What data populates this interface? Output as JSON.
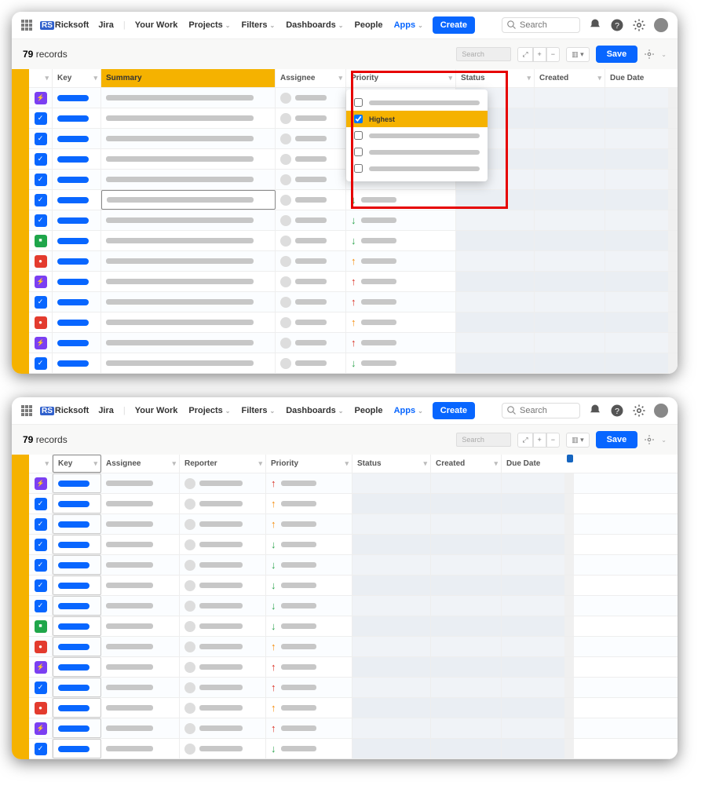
{
  "nav": {
    "brand": "Ricksoft",
    "jira": "Jira",
    "items": [
      "Your Work",
      "Projects",
      "Filters",
      "Dashboards",
      "People",
      "Apps"
    ],
    "active": "Apps",
    "create": "Create",
    "search_placeholder": "Search"
  },
  "toolbar": {
    "record_count": "79",
    "record_label": "records",
    "search_placeholder": "Search",
    "save": "Save"
  },
  "screen1": {
    "headers": {
      "key": "Key",
      "summary": "Summary",
      "assignee": "Assignee",
      "priority": "Priority",
      "status": "Status",
      "created": "Created",
      "due": "Due Date"
    },
    "dropdown": {
      "selected_label": "Highest",
      "options_count": 5,
      "selected_index": 1
    },
    "rows": [
      {
        "icon": "purple",
        "priority": null
      },
      {
        "icon": "blue",
        "priority": null
      },
      {
        "icon": "blue",
        "priority": null
      },
      {
        "icon": "blue",
        "priority": null
      },
      {
        "icon": "blue",
        "priority": null
      },
      {
        "icon": "blue",
        "priority": "down-green",
        "editing": true
      },
      {
        "icon": "blue",
        "priority": "down-green"
      },
      {
        "icon": "green",
        "priority": "down-green"
      },
      {
        "icon": "red",
        "priority": "up-orange"
      },
      {
        "icon": "purple",
        "priority": "up-red"
      },
      {
        "icon": "blue",
        "priority": "up-red"
      },
      {
        "icon": "red",
        "priority": "up-orange"
      },
      {
        "icon": "purple",
        "priority": "up-red"
      },
      {
        "icon": "blue",
        "priority": "down-green"
      }
    ]
  },
  "screen2": {
    "headers": {
      "key": "Key",
      "assignee": "Assignee",
      "reporter": "Reporter",
      "priority": "Priority",
      "status": "Status",
      "created": "Created",
      "due": "Due Date"
    },
    "rows": [
      {
        "icon": "purple",
        "priority": "up-red"
      },
      {
        "icon": "blue",
        "priority": "up-orange"
      },
      {
        "icon": "blue",
        "priority": "up-orange"
      },
      {
        "icon": "blue",
        "priority": "down-green"
      },
      {
        "icon": "blue",
        "priority": "down-green"
      },
      {
        "icon": "blue",
        "priority": "down-green"
      },
      {
        "icon": "blue",
        "priority": "down-green"
      },
      {
        "icon": "green",
        "priority": "down-green"
      },
      {
        "icon": "red",
        "priority": "up-orange"
      },
      {
        "icon": "purple",
        "priority": "up-red"
      },
      {
        "icon": "blue",
        "priority": "up-red"
      },
      {
        "icon": "red",
        "priority": "up-orange"
      },
      {
        "icon": "purple",
        "priority": "up-red"
      },
      {
        "icon": "blue",
        "priority": "down-green"
      }
    ]
  }
}
